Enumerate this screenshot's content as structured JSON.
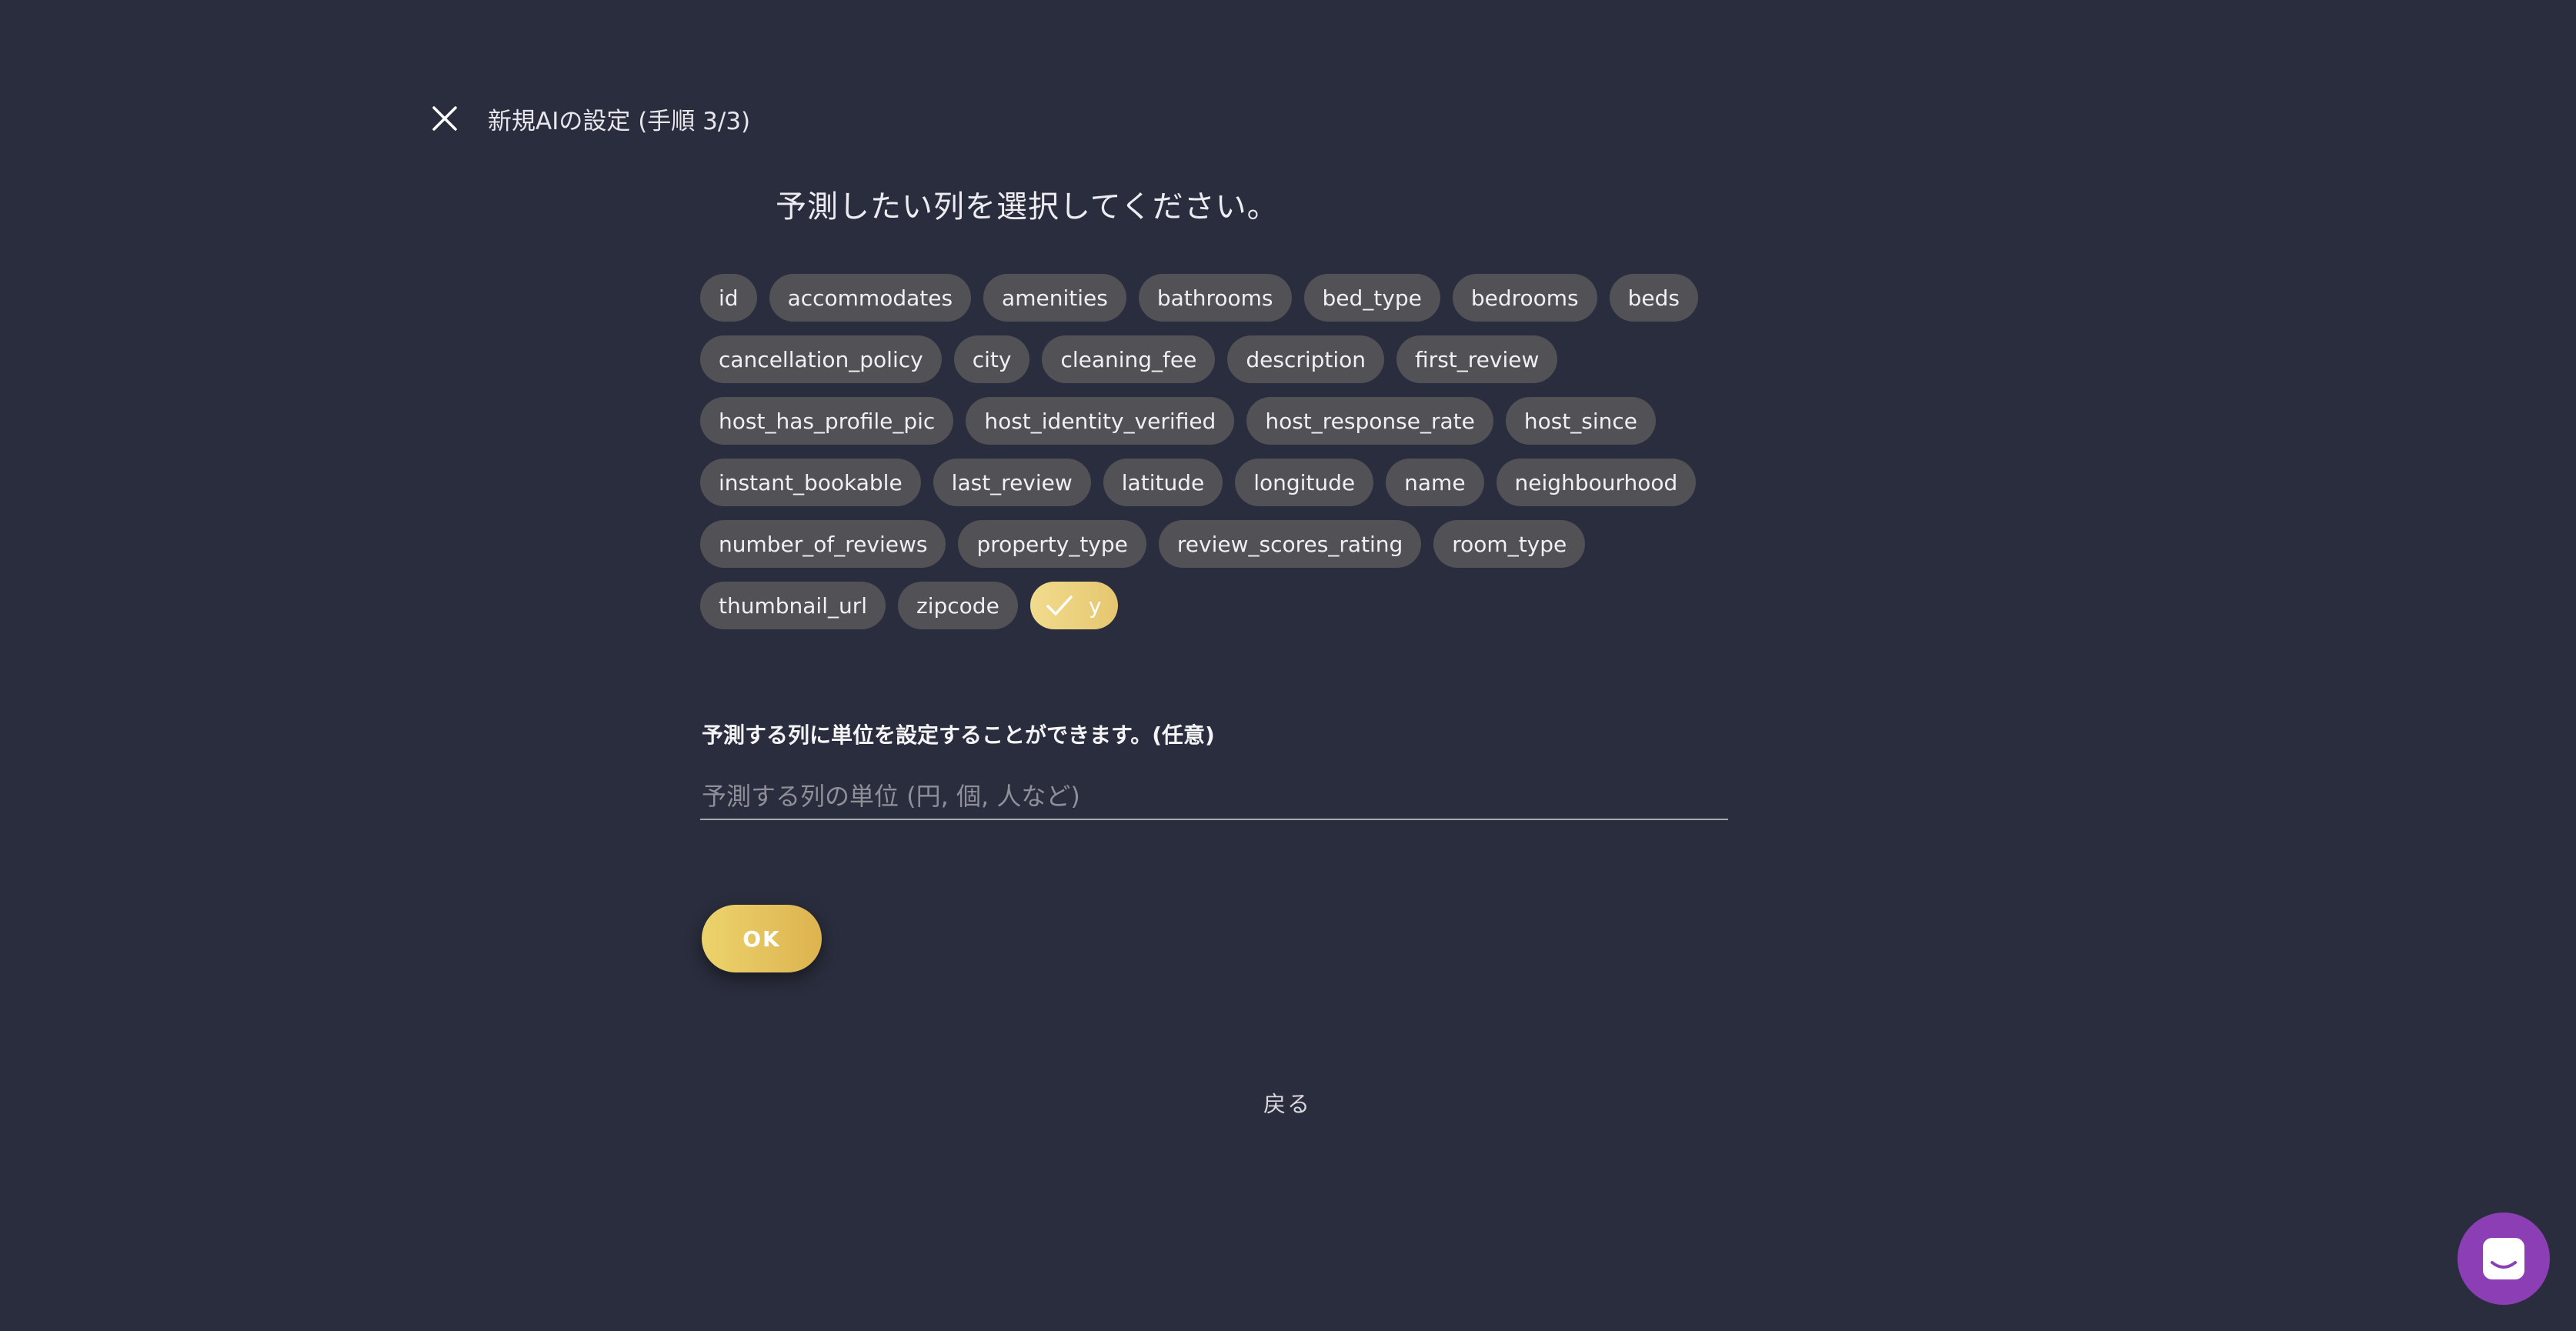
{
  "header": {
    "title": "新規AIの設定 (手順 3/3)",
    "close_icon": "close-icon"
  },
  "prompt": "予測したい列を選択してください。",
  "columns": [
    {
      "label": "id",
      "selected": false
    },
    {
      "label": "accommodates",
      "selected": false
    },
    {
      "label": "amenities",
      "selected": false
    },
    {
      "label": "bathrooms",
      "selected": false
    },
    {
      "label": "bed_type",
      "selected": false
    },
    {
      "label": "bedrooms",
      "selected": false
    },
    {
      "label": "beds",
      "selected": false
    },
    {
      "label": "cancellation_policy",
      "selected": false
    },
    {
      "label": "city",
      "selected": false
    },
    {
      "label": "cleaning_fee",
      "selected": false
    },
    {
      "label": "description",
      "selected": false
    },
    {
      "label": "first_review",
      "selected": false
    },
    {
      "label": "host_has_profile_pic",
      "selected": false
    },
    {
      "label": "host_identity_verified",
      "selected": false
    },
    {
      "label": "host_response_rate",
      "selected": false
    },
    {
      "label": "host_since",
      "selected": false
    },
    {
      "label": "instant_bookable",
      "selected": false
    },
    {
      "label": "last_review",
      "selected": false
    },
    {
      "label": "latitude",
      "selected": false
    },
    {
      "label": "longitude",
      "selected": false
    },
    {
      "label": "name",
      "selected": false
    },
    {
      "label": "neighbourhood",
      "selected": false
    },
    {
      "label": "number_of_reviews",
      "selected": false
    },
    {
      "label": "property_type",
      "selected": false
    },
    {
      "label": "review_scores_rating",
      "selected": false
    },
    {
      "label": "room_type",
      "selected": false
    },
    {
      "label": "thumbnail_url",
      "selected": false
    },
    {
      "label": "zipcode",
      "selected": false
    },
    {
      "label": "y",
      "selected": true
    }
  ],
  "unit": {
    "label": "予測する列に単位を設定することができます。(任意)",
    "placeholder": "予測する列の単位 (円, 個, 人など)",
    "value": ""
  },
  "ok_label": "OK",
  "back_label": "戻る",
  "colors": {
    "background": "#2a2d3d",
    "chip": "#515156",
    "accent": "#e6c670",
    "chat_button": "#8c3fb5"
  },
  "chat_icon": "chat-icon"
}
